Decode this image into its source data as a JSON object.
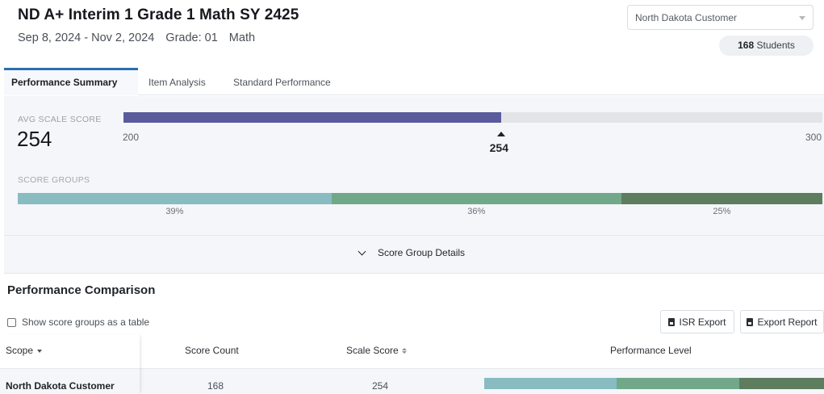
{
  "header": {
    "title": "ND A+ Interim 1 Grade 1 Math SY 2425",
    "date_range": "Sep 8, 2024 - Nov 2, 2024",
    "grade": "Grade: 01",
    "subject": "Math"
  },
  "customer_select": {
    "value": "North Dakota Customer"
  },
  "students": {
    "count": "168",
    "label": "Students"
  },
  "tabs": [
    {
      "label": "Performance Summary",
      "active": true
    },
    {
      "label": "Item Analysis",
      "active": false
    },
    {
      "label": "Standard Performance",
      "active": false
    }
  ],
  "summary": {
    "avg_label": "AVG SCALE SCORE",
    "avg_value": "254",
    "scale_min": "200",
    "scale_max": "300",
    "marker_label": "254",
    "score_value": 254,
    "score_min": 200,
    "score_max": 300,
    "bar_color": "#595b9c",
    "groups_label": "SCORE GROUPS",
    "groups": [
      {
        "percent": 39,
        "label": "39%",
        "color": "#88bcc1"
      },
      {
        "percent": 36,
        "label": "36%",
        "color": "#72a88a"
      },
      {
        "percent": 25,
        "label": "25%",
        "color": "#5d7d5e"
      }
    ],
    "details_label": "Score Group Details"
  },
  "comparison": {
    "title": "Performance Comparison",
    "show_table_label": "Show score groups as a table",
    "isr_export_label": "ISR Export",
    "export_report_label": "Export Report",
    "columns": {
      "scope": "Scope",
      "score_count": "Score Count",
      "scale_score": "Scale Score",
      "performance_level": "Performance Level"
    },
    "rows": [
      {
        "scope": "North Dakota Customer",
        "score_count": "168",
        "scale_score": "254",
        "levels": [
          {
            "percent": 39,
            "color": "#88bcc1"
          },
          {
            "percent": 36,
            "color": "#72a88a"
          },
          {
            "percent": 25,
            "color": "#5d7d5e"
          }
        ]
      }
    ]
  }
}
